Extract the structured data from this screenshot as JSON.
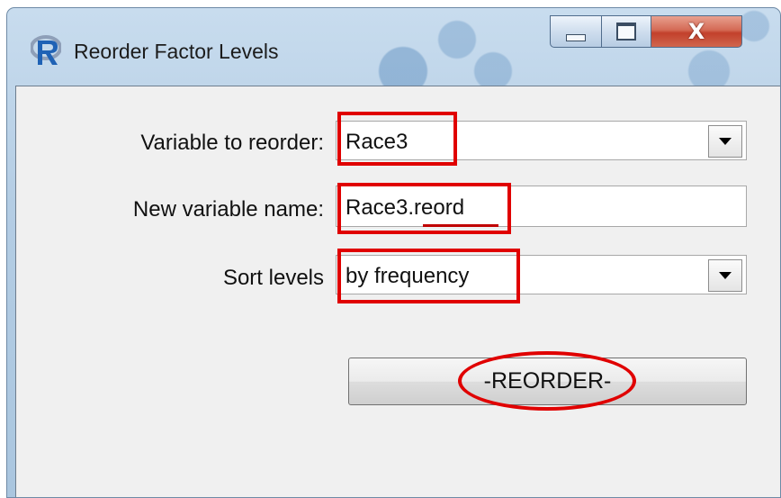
{
  "window": {
    "title": "Reorder Factor Levels",
    "app_icon": "r-logo-icon",
    "controls": {
      "minimize": "minimize-icon",
      "maximize": "maximize-icon",
      "close": "X"
    }
  },
  "form": {
    "variable_label": "Variable to reorder:",
    "variable_value": "Race3",
    "newname_label": "New variable name:",
    "newname_value": "Race3.reord",
    "newname_base": "Race3",
    "newname_suffix": ".reord",
    "sort_label": "Sort levels",
    "sort_value": "by frequency"
  },
  "actions": {
    "reorder_label": "-REORDER-"
  },
  "colors": {
    "annotation": "#e00000",
    "window_frame": "#b4cde4",
    "client_bg": "#f0f0f0"
  }
}
